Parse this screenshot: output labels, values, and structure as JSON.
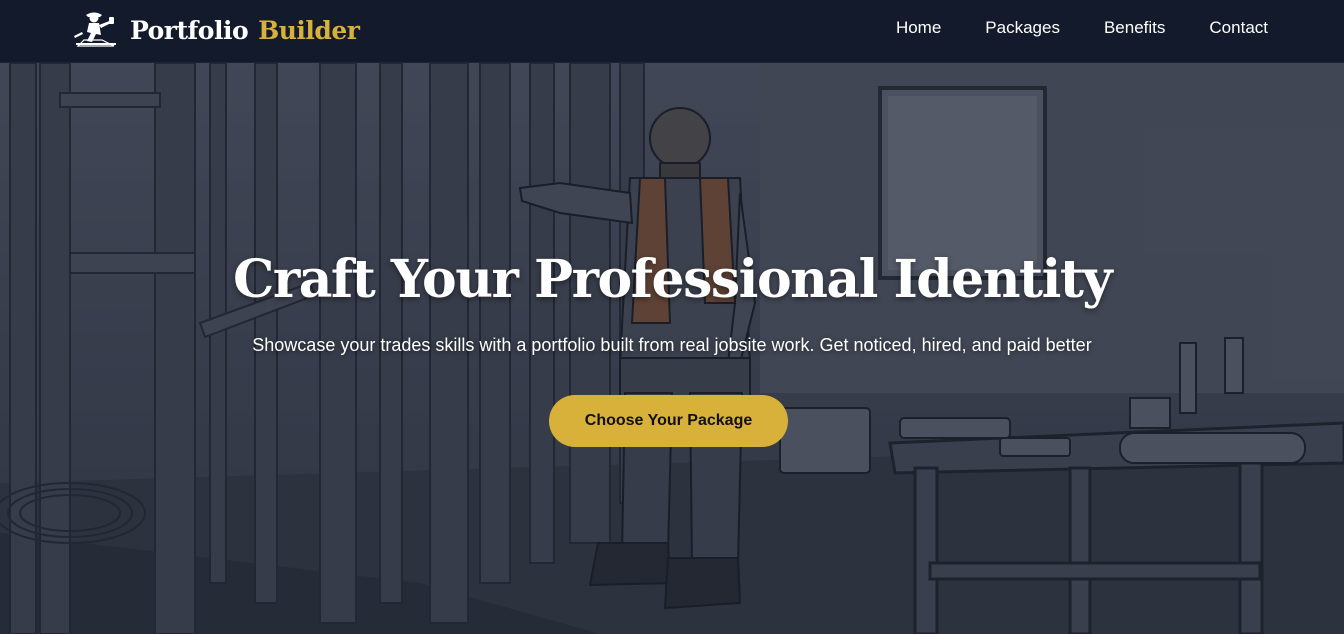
{
  "brand": {
    "logo_icon": "worker-tools-logo-icon",
    "name_part1": "Portfolio",
    "name_part2": "Builder",
    "accent_color": "#d8b13a"
  },
  "nav": {
    "links": [
      {
        "label": "Home"
      },
      {
        "label": "Packages"
      },
      {
        "label": "Benefits"
      },
      {
        "label": "Contact"
      }
    ]
  },
  "hero": {
    "title": "Craft Your Professional Identity",
    "subtitle": "Showcase your trades skills with a portfolio built from real jobsite work. Get noticed, hired, and paid better",
    "cta_label": "Choose Your Package",
    "background": "pencil-sketch-carpenter-at-jobsite-illustration"
  },
  "colors": {
    "nav_background": "#121a2b",
    "cta_background": "#d8b13a",
    "text": "#ffffff"
  }
}
